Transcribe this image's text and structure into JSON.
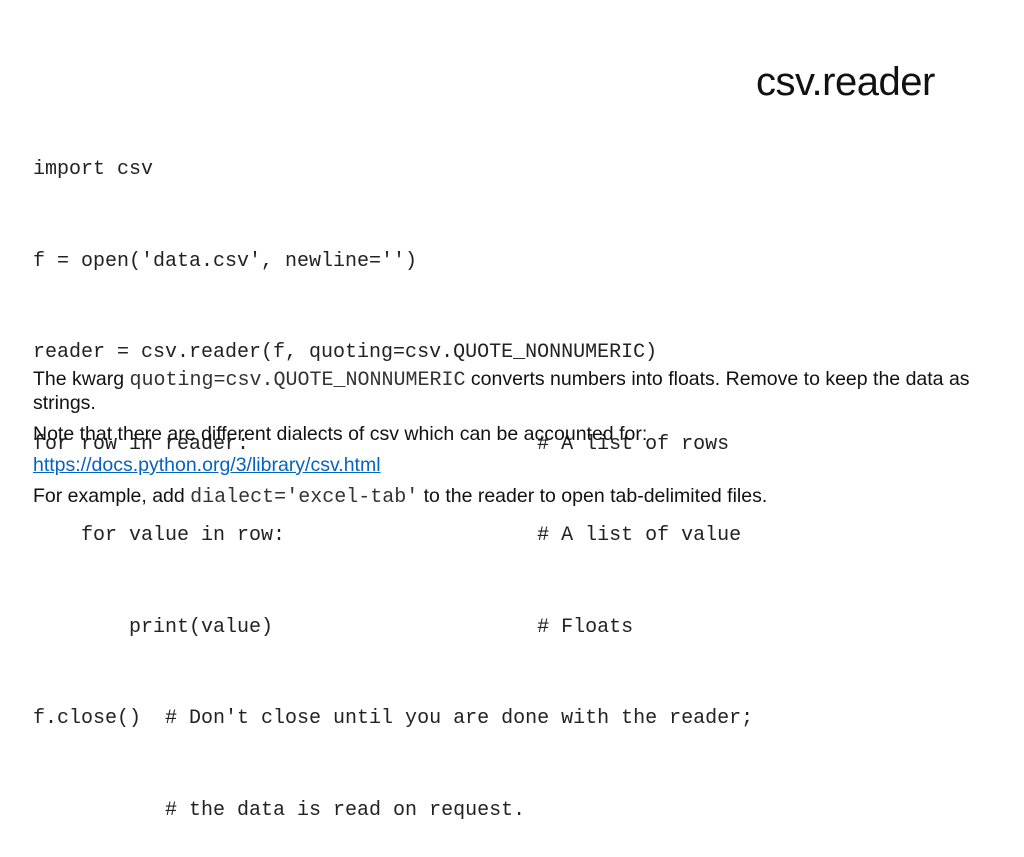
{
  "slide": {
    "title": "csv.reader",
    "code_lines": [
      "import csv",
      "f = open('data.csv', newline='')",
      "reader = csv.reader(f, quoting=csv.QUOTE_NONNUMERIC)",
      "for row in reader:                        # A list of rows",
      "    for value in row:                     # A list of value",
      "        print(value)                      # Floats",
      "f.close()  # Don't close until you are done with the reader;",
      "           # the data is read on request."
    ],
    "paragraph1": {
      "prefix": "The kwarg ",
      "code": "quoting=csv.QUOTE_NONNUMERIC",
      "suffix": " converts numbers into floats. Remove to keep the data as strings."
    },
    "paragraph2": "Note that there are different dialects of csv which can be accounted for:",
    "link": {
      "text": "https://docs.python.org/3/library/csv.html",
      "color": "#0563c1"
    },
    "paragraph3": {
      "prefix": "For example, add ",
      "code": "dialect='excel-tab'",
      "suffix": " to the reader to open tab-delimited files."
    }
  }
}
